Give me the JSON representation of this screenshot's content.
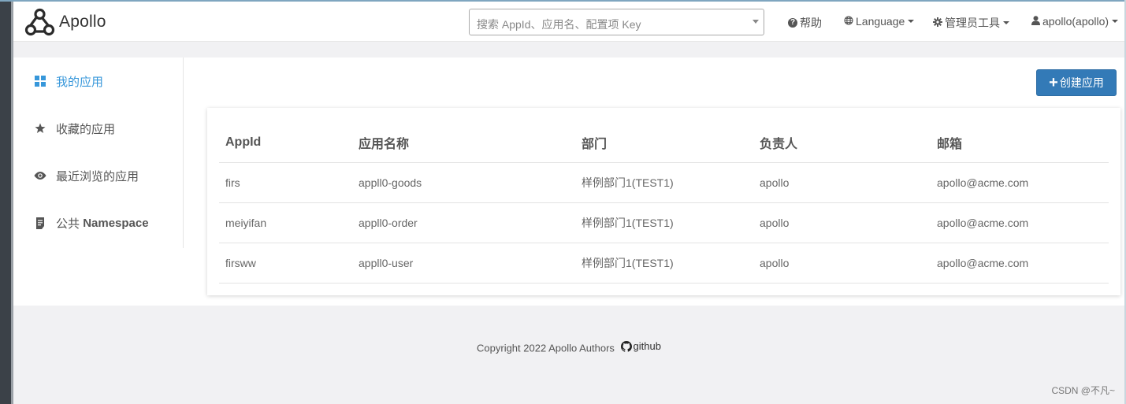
{
  "navbar": {
    "brand": "Apollo",
    "search_placeholder": "搜索 AppId、应用名、配置项 Key",
    "help_label": "帮助",
    "language_label": "Language",
    "admin_tools_label": "管理员工具",
    "user_label": "apollo(apollo)"
  },
  "sidebar": {
    "items": [
      {
        "label": "我的应用",
        "icon": "grid-icon",
        "active": true
      },
      {
        "label": "收藏的应用",
        "icon": "star-icon",
        "active": false
      },
      {
        "label": "最近浏览的应用",
        "icon": "eye-icon",
        "active": false
      },
      {
        "label_prefix": "公共",
        "label_suffix": "Namespace",
        "icon": "book-icon",
        "active": false
      }
    ]
  },
  "main": {
    "create_button_label": "创建应用",
    "table": {
      "headers": [
        "AppId",
        "应用名称",
        "部门",
        "负责人",
        "邮箱"
      ],
      "rows": [
        [
          "firs",
          "appll0-goods",
          "样例部门1(TEST1)",
          "apollo",
          "apollo@acme.com"
        ],
        [
          "meiyifan",
          "appll0-order",
          "样例部门1(TEST1)",
          "apollo",
          "apollo@acme.com"
        ],
        [
          "firsww",
          "appll0-user",
          "样例部门1(TEST1)",
          "apollo",
          "apollo@acme.com"
        ]
      ]
    }
  },
  "footer": {
    "copyright": "Copyright 2022 Apollo Authors",
    "github_label": "github"
  },
  "watermark": "CSDN @不凡~",
  "colors": {
    "accent": "#337ab7",
    "active_link": "#3797da",
    "page_bg": "#f1f1f3"
  }
}
